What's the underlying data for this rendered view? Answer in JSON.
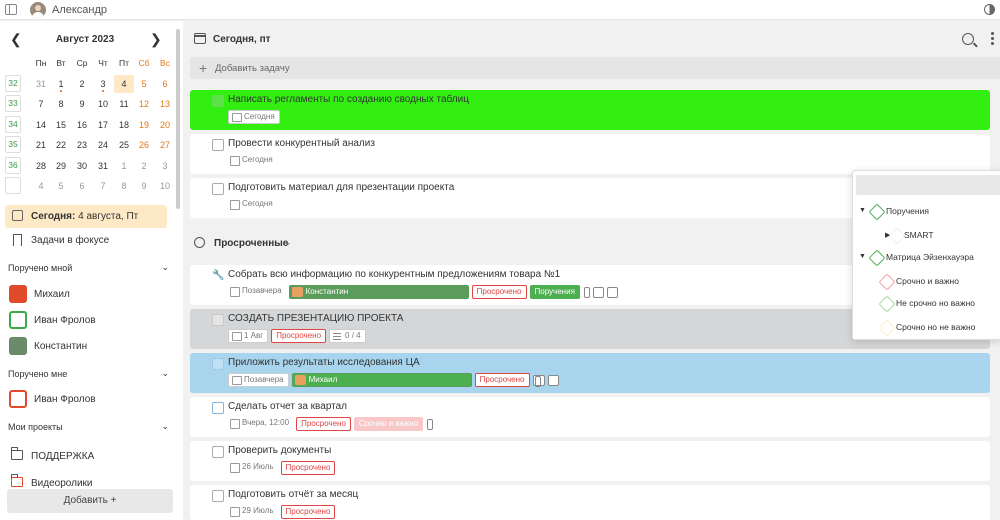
{
  "topbar": {
    "username": "Александр"
  },
  "calendar": {
    "month": "Август 2023",
    "weekdays": [
      "Пн",
      "Вт",
      "Ср",
      "Чт",
      "Пт",
      "Сб",
      "Вс"
    ],
    "weeks": [
      {
        "wk": "32",
        "days": [
          "31",
          "1",
          "2",
          "3",
          "4",
          "5",
          "6"
        ]
      },
      {
        "wk": "33",
        "days": [
          "7",
          "8",
          "9",
          "10",
          "11",
          "12",
          "13"
        ]
      },
      {
        "wk": "34",
        "days": [
          "14",
          "15",
          "16",
          "17",
          "18",
          "19",
          "20"
        ]
      },
      {
        "wk": "35",
        "days": [
          "21",
          "22",
          "23",
          "24",
          "25",
          "26",
          "27"
        ]
      },
      {
        "wk": "36",
        "days": [
          "28",
          "29",
          "30",
          "31",
          "1",
          "2",
          "3"
        ]
      },
      {
        "wk": "",
        "days": [
          "4",
          "5",
          "6",
          "7",
          "8",
          "9",
          "10"
        ]
      }
    ]
  },
  "sidebar": {
    "today_label": "Сегодня:",
    "today_value": "4 августа, Пт",
    "focus": "Задачи в фокусе",
    "assigned_by_me": "Поручено мной",
    "people_by_me": [
      "Михаил",
      "Иван Фролов",
      "Константин"
    ],
    "assigned_to_me": "Поручено мне",
    "people_to_me": [
      "Иван Фролов"
    ],
    "my_projects": "Мои проекты",
    "projects": [
      "ПОДДЕРЖКА",
      "Видеоролики"
    ],
    "add": "Добавить +"
  },
  "main": {
    "title": "Сегодня, пт",
    "add_task": "Добавить задачу",
    "today_tasks": [
      {
        "title": "Написать регламенты по созданию сводных таблиц",
        "date": "Сегодня",
        "bg": "#33ee11"
      },
      {
        "title": "Провести конкурентный анализ",
        "date": "Сегодня",
        "bg": "#ffffff"
      },
      {
        "title": "Подготовить материал для презентации проекта",
        "date": "Сегодня",
        "bg": "#ffffff"
      }
    ],
    "overdue_label": "Просроченные",
    "overdue": [
      {
        "title": "Собрать всю информацию по конкурентным предложениям товара №1",
        "date": "Позавчера",
        "person": "Константин",
        "status": "Просрочено",
        "tag": "Поручения"
      },
      {
        "title": "СОЗДАТЬ ПРЕЗЕНТАЦИЮ ПРОЕКТА",
        "date": "1 Авг",
        "status": "Просрочено",
        "sub": "0 / 4"
      },
      {
        "title": "Приложить результаты исследования ЦА",
        "date": "Позавчера",
        "person": "Михаил",
        "status": "Просрочено"
      },
      {
        "title": "Сделать отчет за квартал",
        "date": "Вчера, 12:00",
        "status": "Просрочено",
        "tag": "Срочно и важно"
      },
      {
        "title": "Проверить документы",
        "date": "26 Июль",
        "status": "Просрочено"
      },
      {
        "title": "Подготовить отчёт за месяц",
        "date": "29 Июль",
        "status": "Просрочено"
      }
    ]
  },
  "popup": {
    "items": [
      "Поручения",
      "SMART",
      "Матрица Эйзенхауэра",
      "Срочно и важно",
      "Не срочно но важно",
      "Срочно но не важно"
    ]
  },
  "colors": {
    "accent_green": "#33ee11",
    "selected_blue": "#a8d4ee",
    "gray_row": "#d4d6d8",
    "overdue_red": "#e04444",
    "today_bg": "#fde9c6"
  }
}
